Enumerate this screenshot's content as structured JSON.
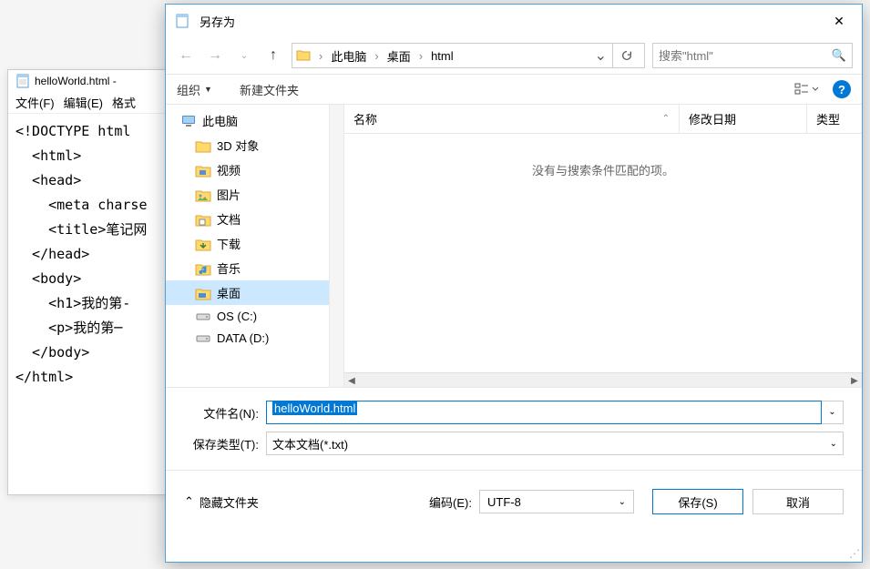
{
  "notepad": {
    "title": "helloWorld.html -",
    "menu": [
      "文件(F)",
      "编辑(E)",
      "格式"
    ],
    "content": "<!DOCTYPE html\n  <html>\n  <head>\n    <meta charse\n    <title>笔记网\n  </head>\n  <body>\n    <h1>我的第-\n    <p>我的第─\n  </body>\n</html>"
  },
  "dialog": {
    "title": "另存为",
    "breadcrumb": [
      "此电脑",
      "桌面",
      "html"
    ],
    "search_placeholder": "搜索\"html\"",
    "organize": "组织",
    "new_folder": "新建文件夹",
    "sidebar": {
      "root": "此电脑",
      "items": [
        {
          "label": "3D 对象",
          "icon": "3d"
        },
        {
          "label": "视频",
          "icon": "video"
        },
        {
          "label": "图片",
          "icon": "picture"
        },
        {
          "label": "文档",
          "icon": "doc"
        },
        {
          "label": "下载",
          "icon": "download"
        },
        {
          "label": "音乐",
          "icon": "music"
        },
        {
          "label": "桌面",
          "icon": "desktop",
          "selected": true
        },
        {
          "label": "OS (C:)",
          "icon": "drive"
        },
        {
          "label": "DATA (D:)",
          "icon": "drive"
        }
      ]
    },
    "file_headers": {
      "name": "名称",
      "date": "修改日期",
      "type": "类型"
    },
    "empty_msg": "没有与搜索条件匹配的项。",
    "filename_label": "文件名(N):",
    "filename_value": "helloWorld.html",
    "filetype_label": "保存类型(T):",
    "filetype_value": "文本文档(*.txt)",
    "hide_folders": "隐藏文件夹",
    "encoding_label": "编码(E):",
    "encoding_value": "UTF-8",
    "save_btn": "保存(S)",
    "cancel_btn": "取消"
  }
}
